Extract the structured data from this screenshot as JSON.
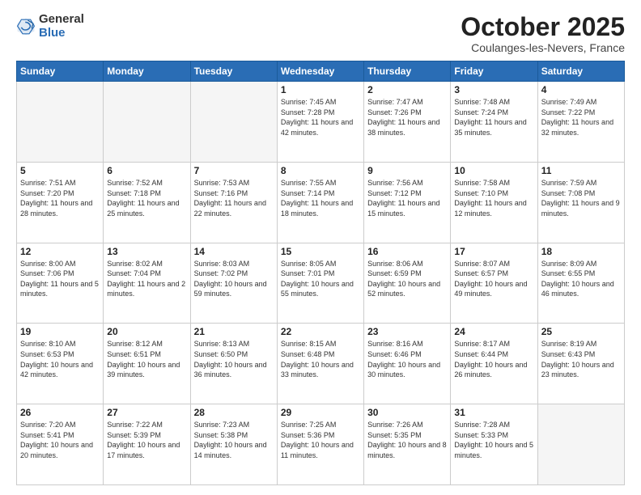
{
  "logo": {
    "general": "General",
    "blue": "Blue"
  },
  "header": {
    "month": "October 2025",
    "location": "Coulanges-les-Nevers, France"
  },
  "weekdays": [
    "Sunday",
    "Monday",
    "Tuesday",
    "Wednesday",
    "Thursday",
    "Friday",
    "Saturday"
  ],
  "weeks": [
    [
      {
        "day": "",
        "info": ""
      },
      {
        "day": "",
        "info": ""
      },
      {
        "day": "",
        "info": ""
      },
      {
        "day": "1",
        "info": "Sunrise: 7:45 AM\nSunset: 7:28 PM\nDaylight: 11 hours and 42 minutes."
      },
      {
        "day": "2",
        "info": "Sunrise: 7:47 AM\nSunset: 7:26 PM\nDaylight: 11 hours and 38 minutes."
      },
      {
        "day": "3",
        "info": "Sunrise: 7:48 AM\nSunset: 7:24 PM\nDaylight: 11 hours and 35 minutes."
      },
      {
        "day": "4",
        "info": "Sunrise: 7:49 AM\nSunset: 7:22 PM\nDaylight: 11 hours and 32 minutes."
      }
    ],
    [
      {
        "day": "5",
        "info": "Sunrise: 7:51 AM\nSunset: 7:20 PM\nDaylight: 11 hours and 28 minutes."
      },
      {
        "day": "6",
        "info": "Sunrise: 7:52 AM\nSunset: 7:18 PM\nDaylight: 11 hours and 25 minutes."
      },
      {
        "day": "7",
        "info": "Sunrise: 7:53 AM\nSunset: 7:16 PM\nDaylight: 11 hours and 22 minutes."
      },
      {
        "day": "8",
        "info": "Sunrise: 7:55 AM\nSunset: 7:14 PM\nDaylight: 11 hours and 18 minutes."
      },
      {
        "day": "9",
        "info": "Sunrise: 7:56 AM\nSunset: 7:12 PM\nDaylight: 11 hours and 15 minutes."
      },
      {
        "day": "10",
        "info": "Sunrise: 7:58 AM\nSunset: 7:10 PM\nDaylight: 11 hours and 12 minutes."
      },
      {
        "day": "11",
        "info": "Sunrise: 7:59 AM\nSunset: 7:08 PM\nDaylight: 11 hours and 9 minutes."
      }
    ],
    [
      {
        "day": "12",
        "info": "Sunrise: 8:00 AM\nSunset: 7:06 PM\nDaylight: 11 hours and 5 minutes."
      },
      {
        "day": "13",
        "info": "Sunrise: 8:02 AM\nSunset: 7:04 PM\nDaylight: 11 hours and 2 minutes."
      },
      {
        "day": "14",
        "info": "Sunrise: 8:03 AM\nSunset: 7:02 PM\nDaylight: 10 hours and 59 minutes."
      },
      {
        "day": "15",
        "info": "Sunrise: 8:05 AM\nSunset: 7:01 PM\nDaylight: 10 hours and 55 minutes."
      },
      {
        "day": "16",
        "info": "Sunrise: 8:06 AM\nSunset: 6:59 PM\nDaylight: 10 hours and 52 minutes."
      },
      {
        "day": "17",
        "info": "Sunrise: 8:07 AM\nSunset: 6:57 PM\nDaylight: 10 hours and 49 minutes."
      },
      {
        "day": "18",
        "info": "Sunrise: 8:09 AM\nSunset: 6:55 PM\nDaylight: 10 hours and 46 minutes."
      }
    ],
    [
      {
        "day": "19",
        "info": "Sunrise: 8:10 AM\nSunset: 6:53 PM\nDaylight: 10 hours and 42 minutes."
      },
      {
        "day": "20",
        "info": "Sunrise: 8:12 AM\nSunset: 6:51 PM\nDaylight: 10 hours and 39 minutes."
      },
      {
        "day": "21",
        "info": "Sunrise: 8:13 AM\nSunset: 6:50 PM\nDaylight: 10 hours and 36 minutes."
      },
      {
        "day": "22",
        "info": "Sunrise: 8:15 AM\nSunset: 6:48 PM\nDaylight: 10 hours and 33 minutes."
      },
      {
        "day": "23",
        "info": "Sunrise: 8:16 AM\nSunset: 6:46 PM\nDaylight: 10 hours and 30 minutes."
      },
      {
        "day": "24",
        "info": "Sunrise: 8:17 AM\nSunset: 6:44 PM\nDaylight: 10 hours and 26 minutes."
      },
      {
        "day": "25",
        "info": "Sunrise: 8:19 AM\nSunset: 6:43 PM\nDaylight: 10 hours and 23 minutes."
      }
    ],
    [
      {
        "day": "26",
        "info": "Sunrise: 7:20 AM\nSunset: 5:41 PM\nDaylight: 10 hours and 20 minutes."
      },
      {
        "day": "27",
        "info": "Sunrise: 7:22 AM\nSunset: 5:39 PM\nDaylight: 10 hours and 17 minutes."
      },
      {
        "day": "28",
        "info": "Sunrise: 7:23 AM\nSunset: 5:38 PM\nDaylight: 10 hours and 14 minutes."
      },
      {
        "day": "29",
        "info": "Sunrise: 7:25 AM\nSunset: 5:36 PM\nDaylight: 10 hours and 11 minutes."
      },
      {
        "day": "30",
        "info": "Sunrise: 7:26 AM\nSunset: 5:35 PM\nDaylight: 10 hours and 8 minutes."
      },
      {
        "day": "31",
        "info": "Sunrise: 7:28 AM\nSunset: 5:33 PM\nDaylight: 10 hours and 5 minutes."
      },
      {
        "day": "",
        "info": ""
      }
    ]
  ]
}
